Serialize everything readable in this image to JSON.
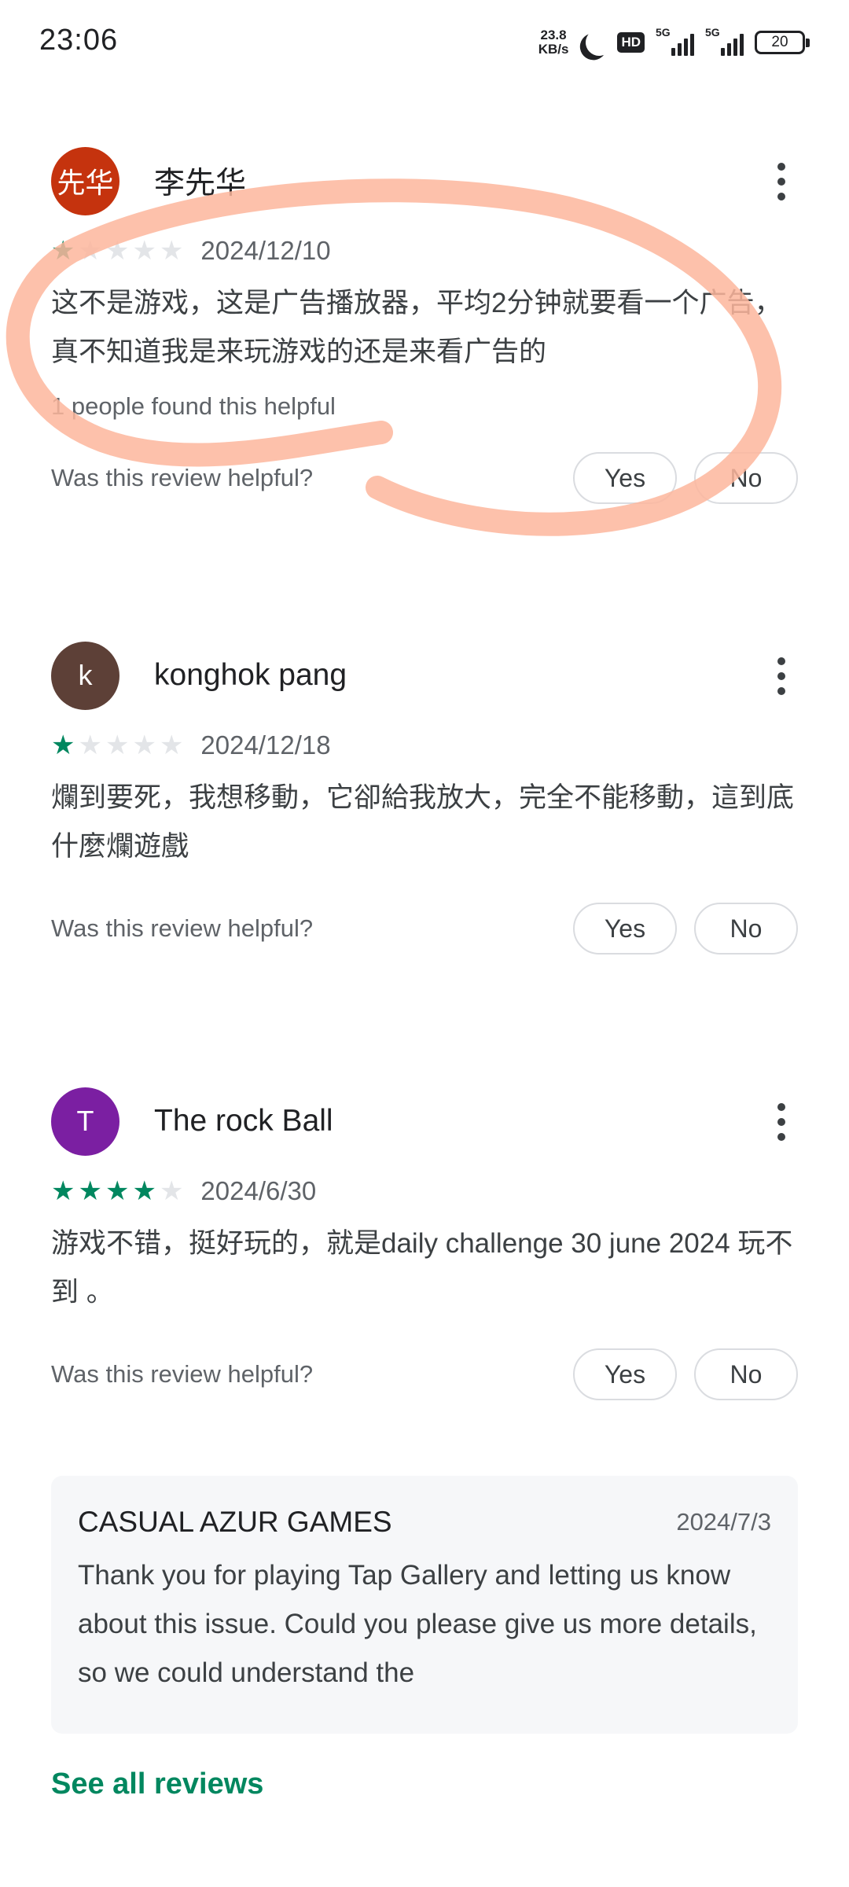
{
  "status_bar": {
    "time": "23:06",
    "net_speed_value": "23.8",
    "net_speed_unit": "KB/s",
    "hd_label": "HD",
    "signal_1_label": "5G",
    "signal_2_label": "5G",
    "battery_level": "20",
    "icons": [
      "moon-icon",
      "hd-icon",
      "signal-icon",
      "battery-icon"
    ]
  },
  "reviews": [
    {
      "avatar_text": "先华",
      "avatar_color": "#c5330e",
      "name": "李先华",
      "rating": 1,
      "rating_max": 5,
      "date": "2024/12/10",
      "text": "这不是游戏，这是广告播放器，平均2分钟就要看一个广告，真不知道我是来玩游戏的还是来看广告的",
      "helpful_count_text": "1 people found this helpful",
      "helpful_question": "Was this review helpful?",
      "yes_label": "Yes",
      "no_label": "No"
    },
    {
      "avatar_text": "k",
      "avatar_color": "#5d4037",
      "name": "konghok pang",
      "rating": 1,
      "rating_max": 5,
      "date": "2024/12/18",
      "text": "爛到要死，我想移動，它卻給我放大，完全不能移動，這到底什麼爛遊戲",
      "helpful_question": "Was this review helpful?",
      "yes_label": "Yes",
      "no_label": "No"
    },
    {
      "avatar_text": "T",
      "avatar_color": "#7b1fa2",
      "name": "The rock Ball",
      "rating": 4,
      "rating_max": 5,
      "date": "2024/6/30",
      "text": "游戏不错，挺好玩的，就是daily challenge 30 june 2024 玩不到 。",
      "helpful_question": "Was this review helpful?",
      "yes_label": "Yes",
      "no_label": "No"
    }
  ],
  "developer_reply": {
    "name": "CASUAL AZUR GAMES",
    "date": "2024/7/3",
    "text": "Thank you for playing Tap Gallery and letting us know about this issue. Could you please give us more details, so we could understand the"
  },
  "see_all_label": "See all reviews",
  "colors": {
    "accent": "#01875f",
    "star_empty": "#e3e5e8",
    "highlight_stroke": "#fdb69c"
  }
}
